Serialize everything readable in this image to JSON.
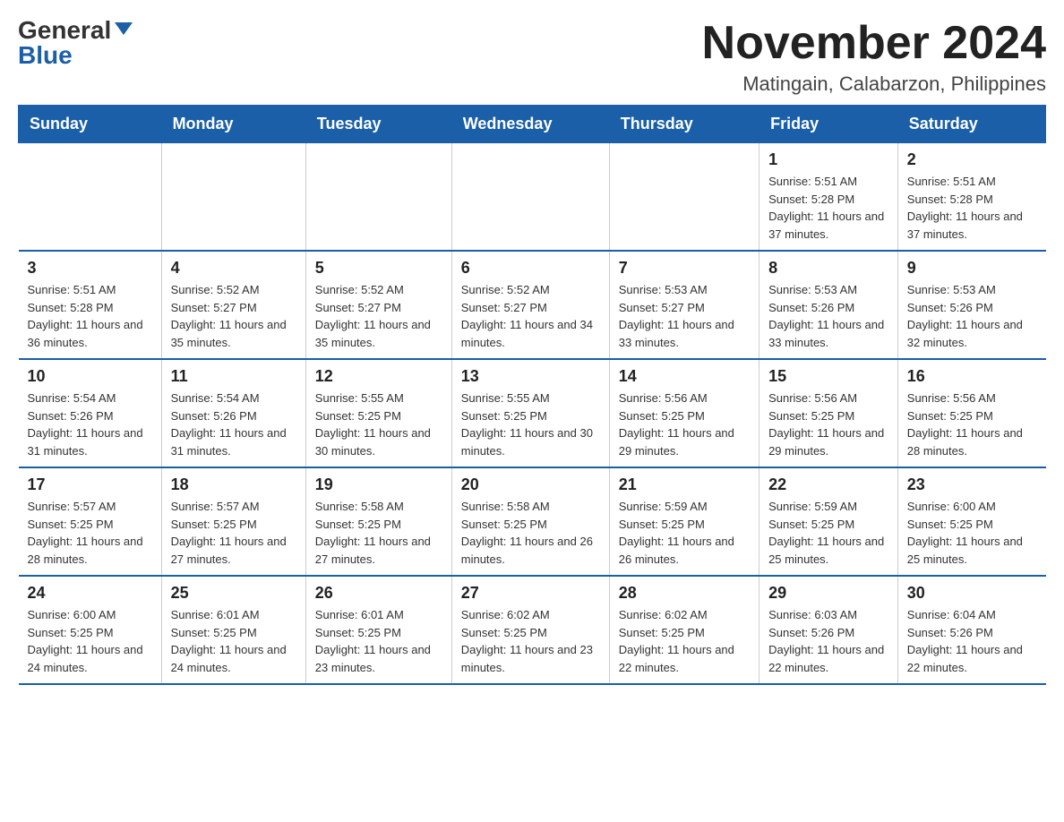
{
  "logo": {
    "general": "General",
    "blue": "Blue"
  },
  "header": {
    "title": "November 2024",
    "subtitle": "Matingain, Calabarzon, Philippines"
  },
  "days_of_week": [
    "Sunday",
    "Monday",
    "Tuesday",
    "Wednesday",
    "Thursday",
    "Friday",
    "Saturday"
  ],
  "weeks": [
    [
      {
        "day": "",
        "info": ""
      },
      {
        "day": "",
        "info": ""
      },
      {
        "day": "",
        "info": ""
      },
      {
        "day": "",
        "info": ""
      },
      {
        "day": "",
        "info": ""
      },
      {
        "day": "1",
        "info": "Sunrise: 5:51 AM\nSunset: 5:28 PM\nDaylight: 11 hours and 37 minutes."
      },
      {
        "day": "2",
        "info": "Sunrise: 5:51 AM\nSunset: 5:28 PM\nDaylight: 11 hours and 37 minutes."
      }
    ],
    [
      {
        "day": "3",
        "info": "Sunrise: 5:51 AM\nSunset: 5:28 PM\nDaylight: 11 hours and 36 minutes."
      },
      {
        "day": "4",
        "info": "Sunrise: 5:52 AM\nSunset: 5:27 PM\nDaylight: 11 hours and 35 minutes."
      },
      {
        "day": "5",
        "info": "Sunrise: 5:52 AM\nSunset: 5:27 PM\nDaylight: 11 hours and 35 minutes."
      },
      {
        "day": "6",
        "info": "Sunrise: 5:52 AM\nSunset: 5:27 PM\nDaylight: 11 hours and 34 minutes."
      },
      {
        "day": "7",
        "info": "Sunrise: 5:53 AM\nSunset: 5:27 PM\nDaylight: 11 hours and 33 minutes."
      },
      {
        "day": "8",
        "info": "Sunrise: 5:53 AM\nSunset: 5:26 PM\nDaylight: 11 hours and 33 minutes."
      },
      {
        "day": "9",
        "info": "Sunrise: 5:53 AM\nSunset: 5:26 PM\nDaylight: 11 hours and 32 minutes."
      }
    ],
    [
      {
        "day": "10",
        "info": "Sunrise: 5:54 AM\nSunset: 5:26 PM\nDaylight: 11 hours and 31 minutes."
      },
      {
        "day": "11",
        "info": "Sunrise: 5:54 AM\nSunset: 5:26 PM\nDaylight: 11 hours and 31 minutes."
      },
      {
        "day": "12",
        "info": "Sunrise: 5:55 AM\nSunset: 5:25 PM\nDaylight: 11 hours and 30 minutes."
      },
      {
        "day": "13",
        "info": "Sunrise: 5:55 AM\nSunset: 5:25 PM\nDaylight: 11 hours and 30 minutes."
      },
      {
        "day": "14",
        "info": "Sunrise: 5:56 AM\nSunset: 5:25 PM\nDaylight: 11 hours and 29 minutes."
      },
      {
        "day": "15",
        "info": "Sunrise: 5:56 AM\nSunset: 5:25 PM\nDaylight: 11 hours and 29 minutes."
      },
      {
        "day": "16",
        "info": "Sunrise: 5:56 AM\nSunset: 5:25 PM\nDaylight: 11 hours and 28 minutes."
      }
    ],
    [
      {
        "day": "17",
        "info": "Sunrise: 5:57 AM\nSunset: 5:25 PM\nDaylight: 11 hours and 28 minutes."
      },
      {
        "day": "18",
        "info": "Sunrise: 5:57 AM\nSunset: 5:25 PM\nDaylight: 11 hours and 27 minutes."
      },
      {
        "day": "19",
        "info": "Sunrise: 5:58 AM\nSunset: 5:25 PM\nDaylight: 11 hours and 27 minutes."
      },
      {
        "day": "20",
        "info": "Sunrise: 5:58 AM\nSunset: 5:25 PM\nDaylight: 11 hours and 26 minutes."
      },
      {
        "day": "21",
        "info": "Sunrise: 5:59 AM\nSunset: 5:25 PM\nDaylight: 11 hours and 26 minutes."
      },
      {
        "day": "22",
        "info": "Sunrise: 5:59 AM\nSunset: 5:25 PM\nDaylight: 11 hours and 25 minutes."
      },
      {
        "day": "23",
        "info": "Sunrise: 6:00 AM\nSunset: 5:25 PM\nDaylight: 11 hours and 25 minutes."
      }
    ],
    [
      {
        "day": "24",
        "info": "Sunrise: 6:00 AM\nSunset: 5:25 PM\nDaylight: 11 hours and 24 minutes."
      },
      {
        "day": "25",
        "info": "Sunrise: 6:01 AM\nSunset: 5:25 PM\nDaylight: 11 hours and 24 minutes."
      },
      {
        "day": "26",
        "info": "Sunrise: 6:01 AM\nSunset: 5:25 PM\nDaylight: 11 hours and 23 minutes."
      },
      {
        "day": "27",
        "info": "Sunrise: 6:02 AM\nSunset: 5:25 PM\nDaylight: 11 hours and 23 minutes."
      },
      {
        "day": "28",
        "info": "Sunrise: 6:02 AM\nSunset: 5:25 PM\nDaylight: 11 hours and 22 minutes."
      },
      {
        "day": "29",
        "info": "Sunrise: 6:03 AM\nSunset: 5:26 PM\nDaylight: 11 hours and 22 minutes."
      },
      {
        "day": "30",
        "info": "Sunrise: 6:04 AM\nSunset: 5:26 PM\nDaylight: 11 hours and 22 minutes."
      }
    ]
  ]
}
